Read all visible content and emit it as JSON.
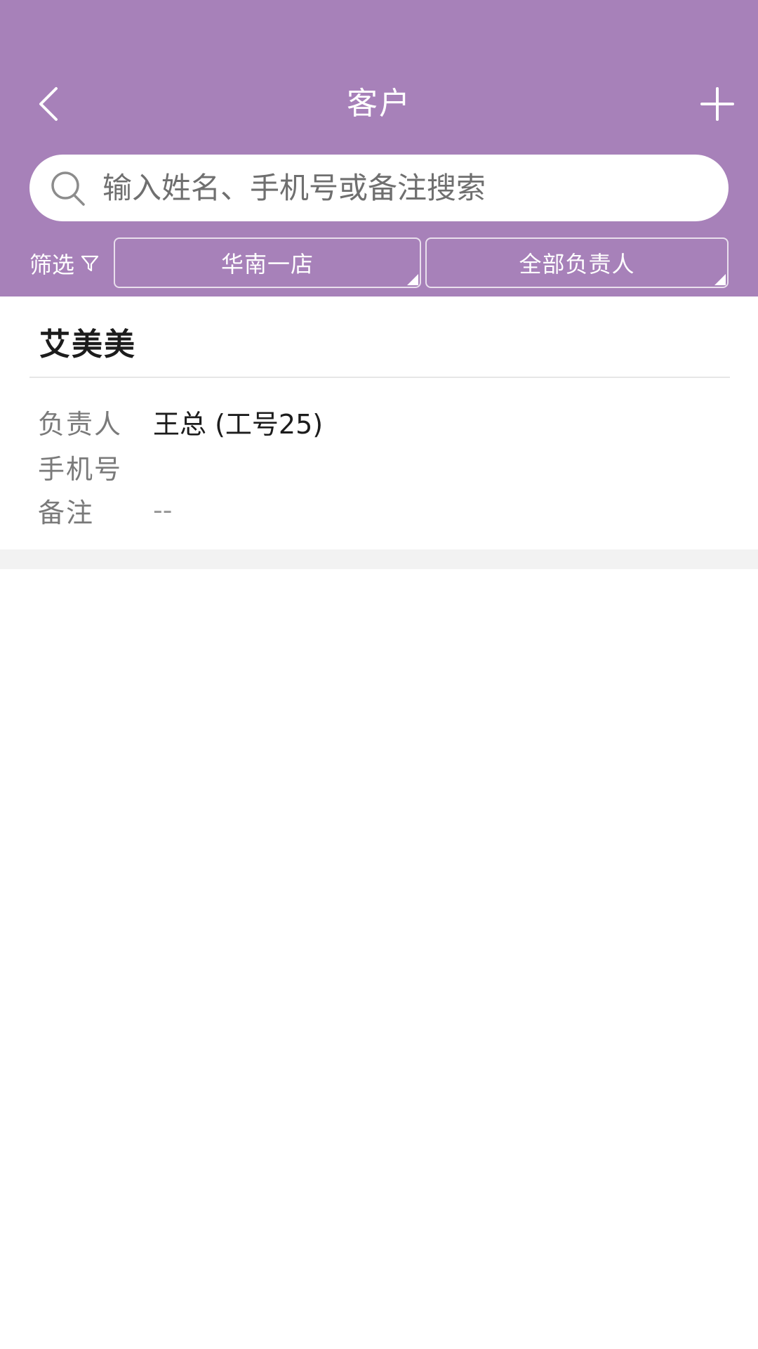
{
  "header": {
    "title": "客户",
    "back_icon": "chevron-left-icon",
    "add_icon": "plus-icon",
    "background_color": "#a781b9"
  },
  "search": {
    "placeholder": "输入姓名、手机号或备注搜索",
    "value": ""
  },
  "filters": {
    "label": "筛选",
    "store_value": "华南一店",
    "owner_value": "全部负责人"
  },
  "customers": [
    {
      "name": "艾美美",
      "owner_label": "负责人",
      "owner_value": "王总 (工号25)",
      "phone_label": "手机号",
      "phone_value": "",
      "note_label": "备注",
      "note_value": "--"
    }
  ]
}
